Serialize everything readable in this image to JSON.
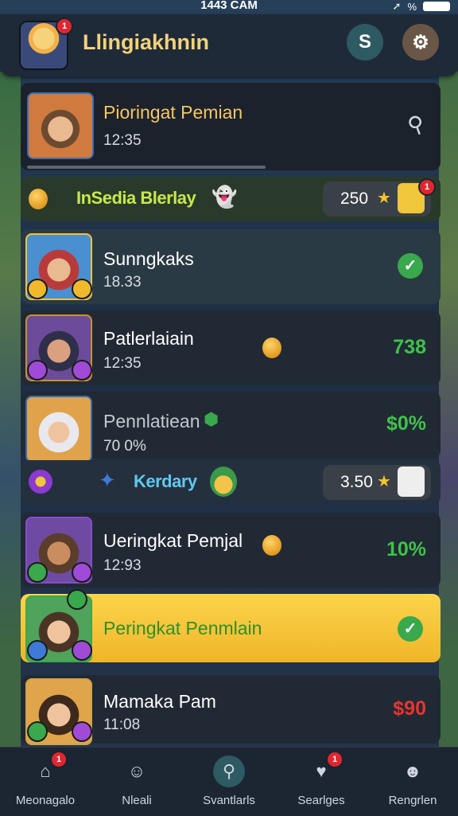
{
  "status": {
    "time": "1443 CAM",
    "battery_text": "%"
  },
  "header": {
    "title": "Llingiakhnin",
    "avatar_badge": "1",
    "search_btn_label": "S",
    "settings_icon": "gear-icon"
  },
  "top_card": {
    "name": "Pioringat Pemian",
    "time": "12:35"
  },
  "banner1": {
    "title": "InSedia Blerlay",
    "score": "250",
    "badge": "1"
  },
  "entries": [
    {
      "name": "Sunngkaks",
      "time": "18.33",
      "status": "check"
    },
    {
      "name": "Patlerlaiain",
      "time": "12:35",
      "value": "738",
      "value_color": "#3fc24a"
    },
    {
      "name": "Pennlatiean",
      "time": "70 0%",
      "value": "$0%",
      "value_color": "#3fc24a"
    }
  ],
  "banner2": {
    "title": "Kerdary",
    "score": "3.50"
  },
  "entries2": [
    {
      "name": "Ueringkat Pemjal",
      "time": "12:93",
      "value": "10%",
      "value_color": "#3fc24a"
    },
    {
      "name": "Peringkat Penmlain",
      "status": "check",
      "highlight": true
    },
    {
      "name": "Mamaka Pam",
      "time": "11:08",
      "value": "$90",
      "value_color": "#e8342f"
    }
  ],
  "nav": [
    {
      "label": "Meonagalo",
      "icon": "home-icon",
      "badge": "1"
    },
    {
      "label": "Nleali",
      "icon": "face-icon"
    },
    {
      "label": "Svantlarls",
      "icon": "search-icon"
    },
    {
      "label": "Searlges",
      "icon": "heart-icon",
      "badge": "1"
    },
    {
      "label": "Rengrlen",
      "icon": "profile-icon"
    }
  ]
}
